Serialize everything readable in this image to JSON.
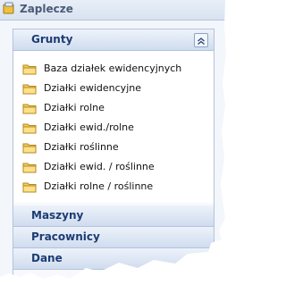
{
  "window": {
    "title": "Zaplecze"
  },
  "groups": {
    "grunty": {
      "label": "Grunty",
      "items": [
        {
          "label": "Baza działek ewidencyjnych"
        },
        {
          "label": "Działki ewidencyjne"
        },
        {
          "label": "Działki rolne"
        },
        {
          "label": "Działki ewid./rolne"
        },
        {
          "label": "Działki roślinne"
        },
        {
          "label": "Działki ewid. / roślinne"
        },
        {
          "label": "Działki rolne / roślinne"
        }
      ]
    },
    "maszyny": {
      "label": "Maszyny"
    },
    "pracownicy": {
      "label": "Pracownicy"
    },
    "dane": {
      "label": "Dane"
    }
  },
  "icons": {
    "title": "app-icon",
    "collapse": "double-chevron-up-icon",
    "item": "folder-icon"
  },
  "colors": {
    "header_text": "#1c3c73",
    "folder": "#f2c94c"
  }
}
